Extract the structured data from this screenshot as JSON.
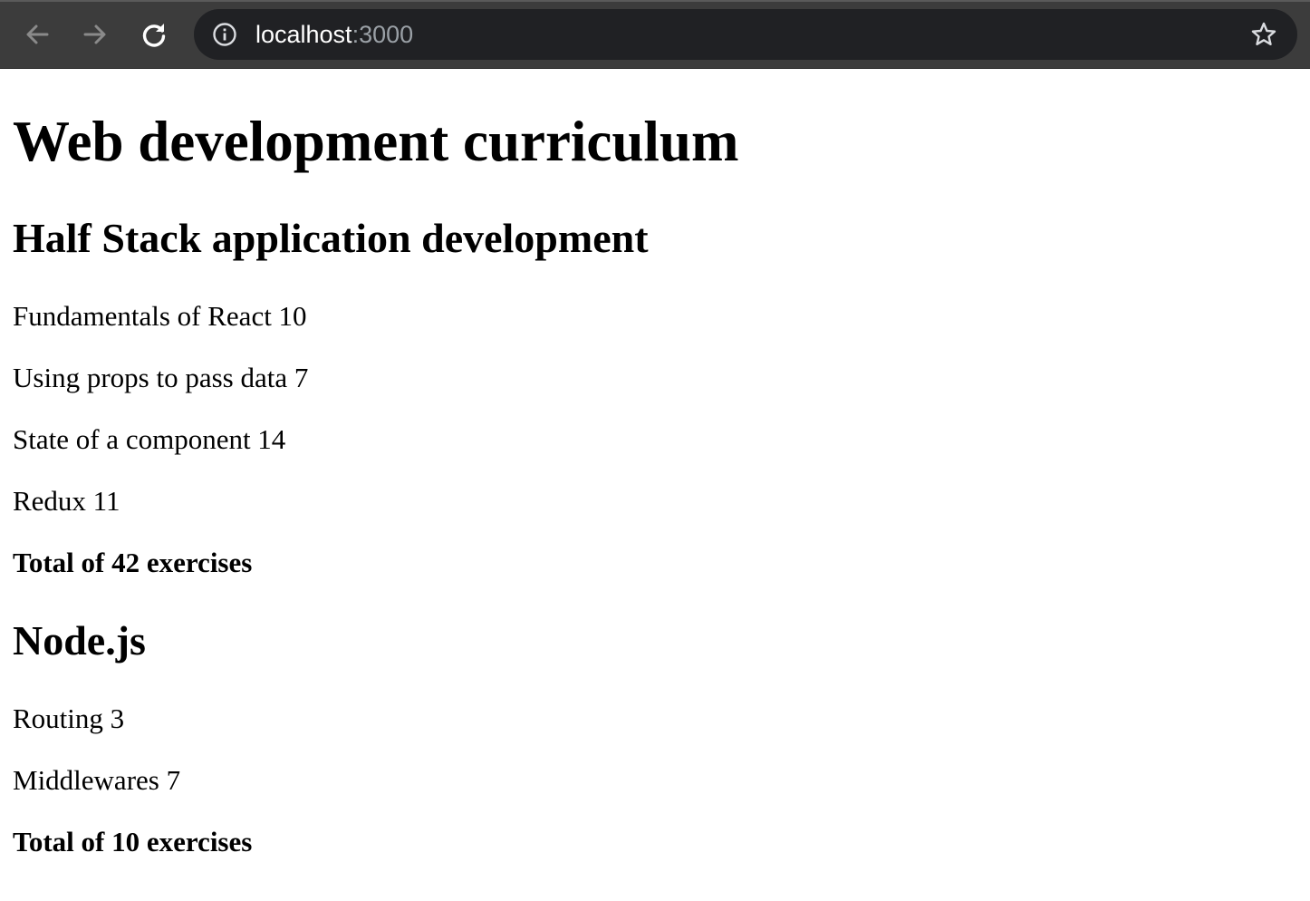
{
  "browser": {
    "url_host": "localhost",
    "url_port": ":3000"
  },
  "page": {
    "title": "Web development curriculum",
    "courses": [
      {
        "name": "Half Stack application development",
        "parts": [
          {
            "text": "Fundamentals of React 10"
          },
          {
            "text": "Using props to pass data 7"
          },
          {
            "text": "State of a component 14"
          },
          {
            "text": "Redux 11"
          }
        ],
        "total": "Total of 42 exercises"
      },
      {
        "name": "Node.js",
        "parts": [
          {
            "text": "Routing 3"
          },
          {
            "text": "Middlewares 7"
          }
        ],
        "total": "Total of 10 exercises"
      }
    ]
  }
}
